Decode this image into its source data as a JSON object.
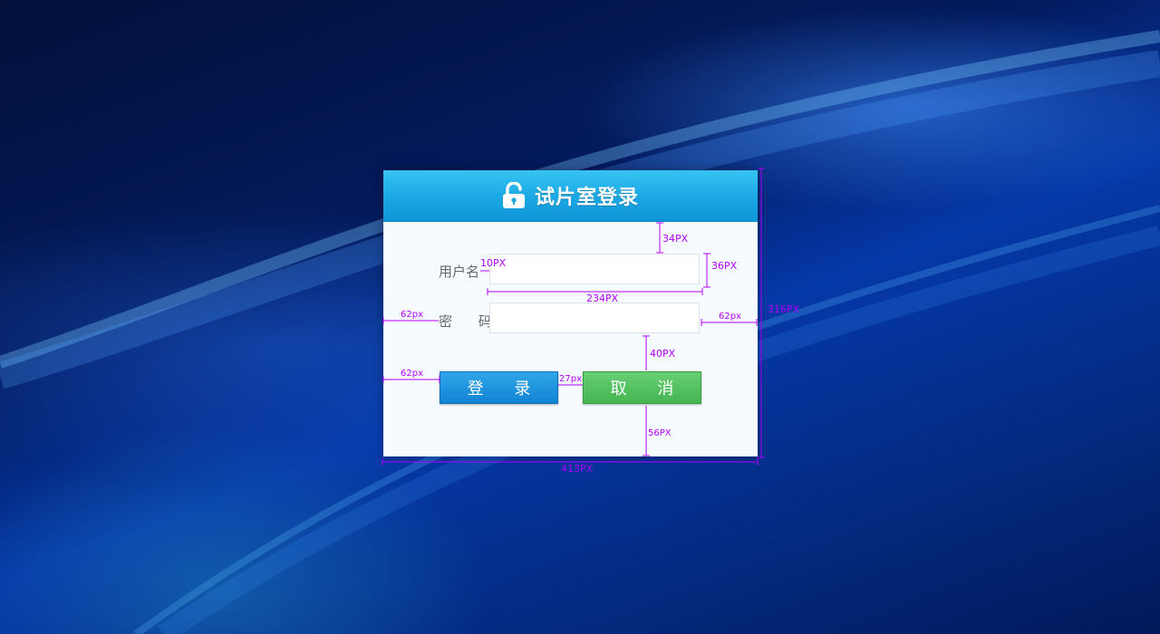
{
  "dialog": {
    "title": "试片室登录",
    "lock_icon": "lock-open-icon",
    "username_label": "用户名",
    "password_label": "密 码",
    "username_value": "",
    "password_value": "",
    "login_button": "登 录",
    "cancel_button": "取 消",
    "header_color": "#1ba7e4",
    "login_color": "#1384d4",
    "cancel_color": "#46b552"
  },
  "annotations": {
    "top_gap": "34PX",
    "input_height": "36PX",
    "input_width": "234PX",
    "label_gap": "10PX",
    "left_margin_field": "62px",
    "right_margin_field": "62px",
    "field_button_gap": "40PX",
    "left_margin_button": "62px",
    "button_gap": "27px",
    "bottom_gap": "56PX",
    "dialog_height": "316PX",
    "dialog_width": "413PX",
    "annotation_color": "#b000ff"
  }
}
